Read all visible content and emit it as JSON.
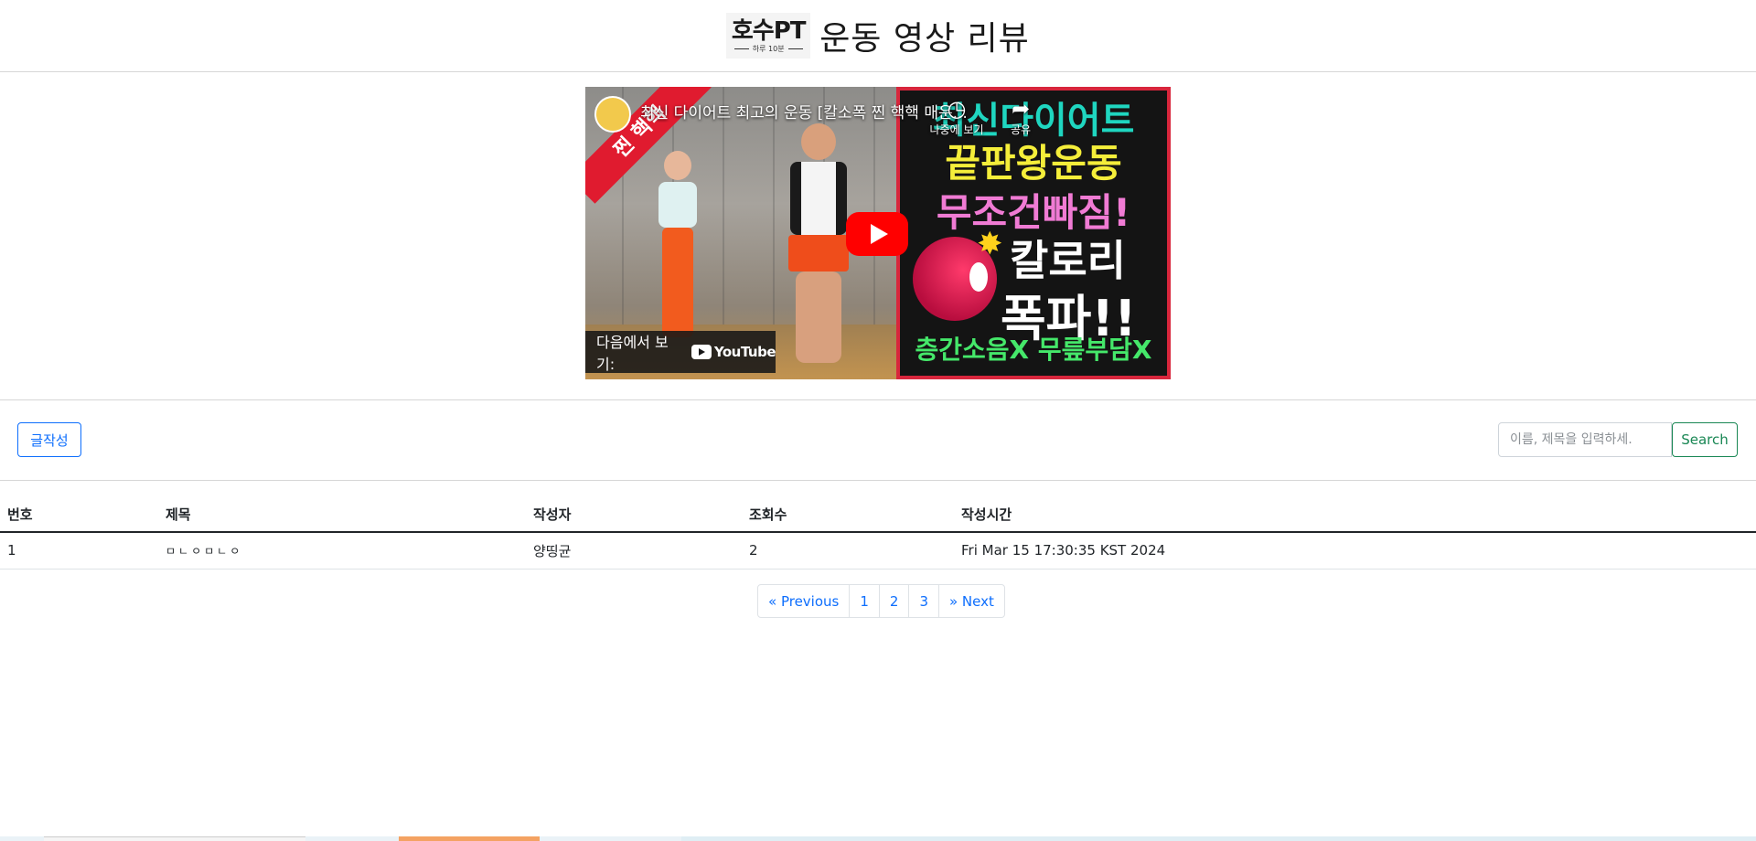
{
  "header": {
    "logo_main": "호수PT",
    "logo_sub": "하루 10분",
    "title": "운동 영상 리뷰"
  },
  "video": {
    "title": "최신 다이어트 최고의 운동 [칼소폭 찐 핵핵 매운...",
    "watch_later_label": "나중에 보기",
    "share_label": "공유",
    "watch_on_label": "다음에서 보기:",
    "youtube_label": "YouTube",
    "thumbnail_lines": [
      "최신다이어트",
      "끝판왕운동",
      "무조건빠짐!",
      "칼로리",
      "폭파!!",
      "층간소음X 무릎부담X"
    ],
    "ribbon_text": "찐 핵핵"
  },
  "toolbar": {
    "write_label": "글작성",
    "search_placeholder": "이름, 제목을 입력하세.",
    "search_label": "Search"
  },
  "table": {
    "headers": [
      "번호",
      "제목",
      "작성자",
      "조회수",
      "작성시간"
    ],
    "rows": [
      {
        "no": "1",
        "title": "ㅁㄴㅇㅁㄴㅇ",
        "writer": "양띵균",
        "views": "2",
        "time": "Fri Mar 15 17:30:35 KST 2024"
      }
    ]
  },
  "pagination": {
    "prev": "« Previous",
    "pages": [
      "1",
      "2",
      "3"
    ],
    "next": "» Next"
  },
  "colors": {
    "primary": "#0d6efd",
    "success": "#198754",
    "youtube_red": "#ff0000"
  }
}
